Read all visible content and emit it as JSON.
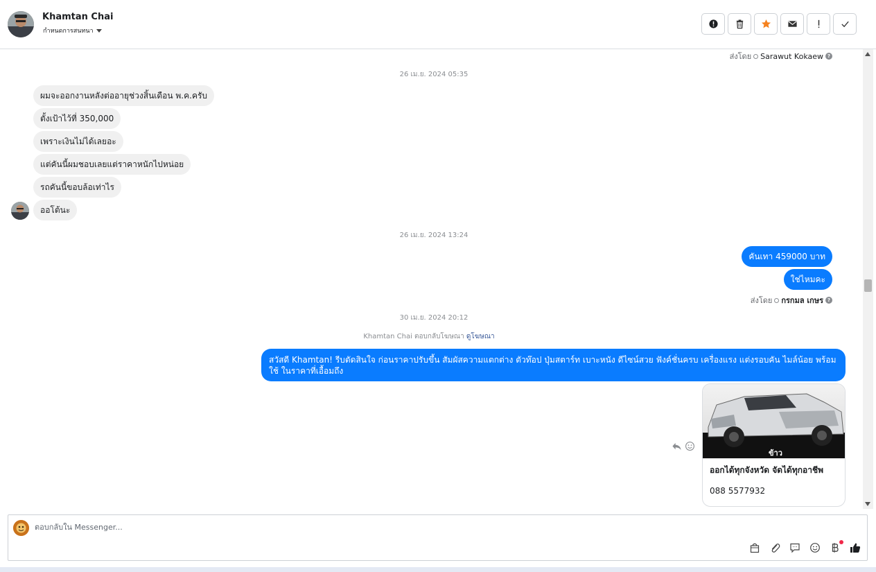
{
  "header": {
    "contact_name": "Khamtan Chai",
    "assign_label": "กำหนดการสนทนา"
  },
  "toolbar": {
    "buttons": [
      "report-icon",
      "trash-icon",
      "star-icon",
      "envelope-icon",
      "exclamation-icon",
      "check-icon"
    ]
  },
  "colors": {
    "accent": "#0a7cff",
    "star": "#f5821f",
    "incoming_bubble": "#f0f0f0"
  },
  "conversation": {
    "sent_by_label": "ส่งโดย",
    "sent_by_top": "Sarawut Kokaew",
    "timestamps": [
      "26 เม.ย. 2024 05:35",
      "26 เม.ย. 2024 13:24",
      "30 เม.ย. 2024 20:12"
    ],
    "incoming_messages": [
      "ผมจะออกงานหลังต่ออายุช่วงสิ้นเดือน พ.ค.ครับ",
      "ตั้งเป้าไว้ที่ 350,000",
      "เพราะเงินไม่ได้เลยอะ",
      "แต่คันนี้ผมชอบเลยแต่ราคาหนักไปหน่อย",
      "รถคันนี้ขอบล้อเท่าไร",
      "ออโต้นะ"
    ],
    "outgoing_messages": [
      "คันเทา 459000 บาท",
      "ใช่ไหมคะ"
    ],
    "sent_by_mid": "กรกมล เกษร",
    "ad_reply_prefix": "Khamtan Chai ตอบกลับโฆษณา",
    "ad_reply_link": "ดูโฆษณา",
    "ad_message": "สวัสดี Khamtan!  รีบตัดสินใจ ก่อนราคาปรับขึ้น สัมผัสความแตกต่าง ตัวท๊อป ปุ่มสตาร์ท เบาะหนัง ดีไซน์สวย ฟังค์ชั่นครบ เครื่องแรง แต่งรอบคัน ไมล์น้อย พร้อมใช้ ในราคาที่เอื้อมถึง",
    "card": {
      "image_caption": "ข้าว",
      "title": "ออกได้ทุกจังหวัด จัดได้ทุกอาชีพ",
      "phone": "088 5577932"
    }
  },
  "composer": {
    "placeholder": "ตอบกลับใน Messenger...",
    "tools": [
      "bag-icon",
      "paperclip-icon",
      "saved-reply-icon",
      "emoji-icon",
      "baht-icon",
      "thumbs-up-icon"
    ]
  }
}
